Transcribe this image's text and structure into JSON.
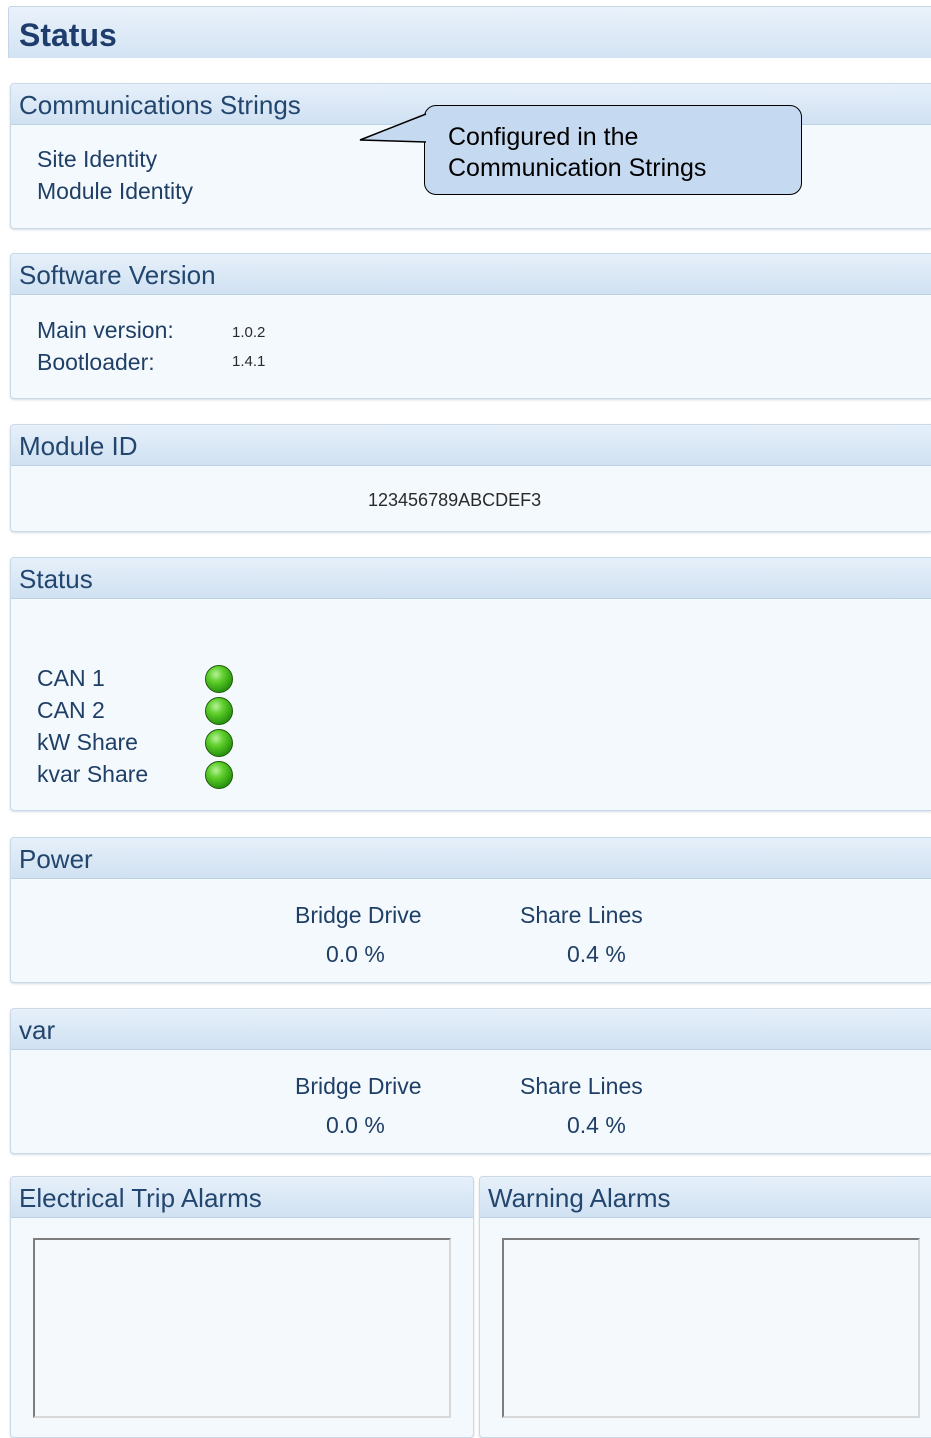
{
  "page_title": "Status",
  "comm_strings": {
    "title": "Communications Strings",
    "items": [
      "Site Identity",
      "Module Identity"
    ]
  },
  "callout": {
    "line1": "Configured in the",
    "line2": "Communication Strings"
  },
  "software": {
    "title": "Software Version",
    "main_label": "Main version:",
    "main_value": "1.0.2",
    "boot_label": "Bootloader:",
    "boot_value": "1.4.1"
  },
  "module_id": {
    "title": "Module ID",
    "value": "123456789ABCDEF3"
  },
  "status": {
    "title": "Status",
    "indicators": [
      {
        "label": "CAN 1",
        "state": "on",
        "color": "#3cb01a"
      },
      {
        "label": "CAN 2",
        "state": "on",
        "color": "#3cb01a"
      },
      {
        "label": "kW Share",
        "state": "on",
        "color": "#3cb01a"
      },
      {
        "label": "kvar Share",
        "state": "on",
        "color": "#3cb01a"
      }
    ]
  },
  "power": {
    "title": "Power",
    "bridge_label": "Bridge Drive",
    "bridge_value": "0.0 %",
    "share_label": "Share Lines",
    "share_value": "0.4 %"
  },
  "var": {
    "title": "var",
    "bridge_label": "Bridge Drive",
    "bridge_value": "0.0 %",
    "share_label": "Share Lines",
    "share_value": "0.4 %"
  },
  "alarms": {
    "electrical_title": "Electrical Trip Alarms",
    "warning_title": "Warning Alarms"
  }
}
